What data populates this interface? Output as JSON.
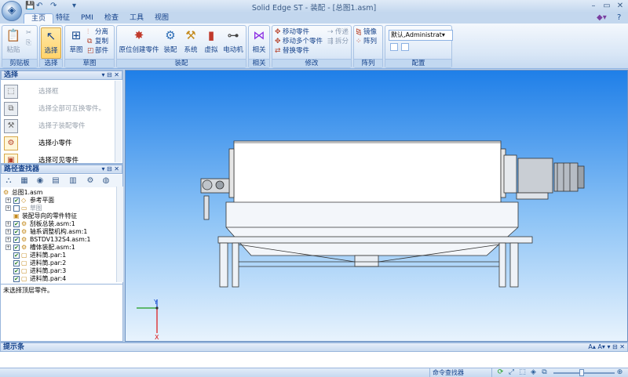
{
  "window": {
    "title": "Solid Edge ST - 装配 - [总图1.asm]",
    "app_orb_glyph": "◈"
  },
  "quick_access": [
    "💾",
    "↶",
    "↷",
    "▾"
  ],
  "tabs": [
    {
      "label": "主页",
      "active": true
    },
    {
      "label": "特征"
    },
    {
      "label": "PMI"
    },
    {
      "label": "检查"
    },
    {
      "label": "工具"
    },
    {
      "label": "视图"
    }
  ],
  "ribbon": {
    "clipboard": {
      "label": "剪贴板",
      "paste": "粘贴"
    },
    "select": {
      "label": "选择",
      "button": "选择"
    },
    "sketch": {
      "label": "草图",
      "button": "草图",
      "split": "分离",
      "copy": "复制",
      "part": "部件"
    },
    "assembly": {
      "label": "装配",
      "buttons": [
        "原位创建零件",
        "装配",
        "系统",
        "虚拟",
        "电动机"
      ]
    },
    "relations": {
      "label": "相关",
      "button": "相关"
    },
    "modify": {
      "label": "修改",
      "move_part": "移动零件",
      "move_parts": "移动多个零件",
      "replace_part": "替换零件",
      "transfer": "传递",
      "disperse": "拆分"
    },
    "pattern": {
      "label": "阵列",
      "mirror": "镜像",
      "array": "阵列"
    },
    "config": {
      "label": "配置",
      "select_value": "默认,Administrat▾"
    }
  },
  "select_panel": {
    "title": "选择",
    "items": [
      {
        "label": "选择框",
        "state": "dim"
      },
      {
        "label": "选择全部可互换零件。",
        "state": "dim"
      },
      {
        "label": "选择子装配零件",
        "state": "dim"
      },
      {
        "label": "选择小零件",
        "state": "on"
      },
      {
        "label": "选择可见零件",
        "state": "on"
      }
    ]
  },
  "pathfinder": {
    "title": "路径查找器",
    "toolbar": [
      "⛬",
      "▦",
      "◉",
      "▤",
      "▥",
      "⚙",
      "◍"
    ],
    "tree": [
      {
        "label": "总图1.asm",
        "indent": 0,
        "icon": "⚙",
        "exp": "",
        "check": false,
        "greyed": false
      },
      {
        "label": "参考平面",
        "indent": 1,
        "icon": "◇",
        "exp": "+",
        "check": true,
        "greyed": false
      },
      {
        "label": "草图",
        "indent": 1,
        "icon": "▭",
        "exp": "+",
        "check": "empty",
        "greyed": true
      },
      {
        "label": "装配导向的零件特征",
        "indent": 1,
        "icon": "▣",
        "exp": "",
        "check": false,
        "greyed": false
      },
      {
        "label": "刮板总装.asm:1",
        "indent": 1,
        "icon": "⚙",
        "exp": "+",
        "check": true,
        "greyed": false
      },
      {
        "label": "轴系调整机构.asm:1",
        "indent": 1,
        "icon": "⚙",
        "exp": "+",
        "check": true,
        "greyed": false
      },
      {
        "label": "BSTDV132S4.asm:1",
        "indent": 1,
        "icon": "⚙",
        "exp": "+",
        "check": true,
        "greyed": false
      },
      {
        "label": "槽体装配.asm:1",
        "indent": 1,
        "icon": "⚙",
        "exp": "+",
        "check": true,
        "greyed": false
      },
      {
        "label": "进料筒.par:1",
        "indent": 1,
        "icon": "▢",
        "exp": "",
        "check": true,
        "greyed": false
      },
      {
        "label": "进料筒.par:2",
        "indent": 1,
        "icon": "▢",
        "exp": "",
        "check": true,
        "greyed": false
      },
      {
        "label": "进料筒.par:3",
        "indent": 1,
        "icon": "▢",
        "exp": "",
        "check": true,
        "greyed": false
      },
      {
        "label": "进料筒.par:4",
        "indent": 1,
        "icon": "▢",
        "exp": "",
        "check": true,
        "greyed": false
      }
    ],
    "status": "未选择顶层零件。"
  },
  "viewport": {
    "axis_y": "Y",
    "axis_x": "X"
  },
  "prompt": {
    "title": "提示条"
  },
  "statusbar": {
    "command_finder": "命令查找器",
    "icons": [
      "⟳",
      "⤢",
      "⬚",
      "◈",
      "⧉",
      "⊕",
      "◰"
    ]
  }
}
